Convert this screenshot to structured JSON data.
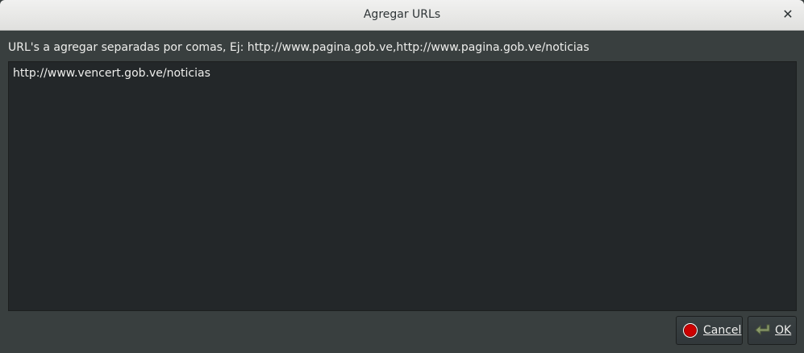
{
  "window": {
    "title": "Agregar URLs",
    "close_glyph": "✕"
  },
  "instructions": "URL's a agregar separadas por comas, Ej: http://www.pagina.gob.ve,http://www.pagina.gob.ve/noticias",
  "url_input": {
    "value": "http://www.vencert.gob.ve/noticias"
  },
  "buttons": {
    "cancel": {
      "label": "Cancel",
      "icon": "stop-icon"
    },
    "ok": {
      "label": "OK",
      "icon": "return-arrow-icon"
    }
  },
  "colors": {
    "background": "#393f3f",
    "text_area": "#232729",
    "stop_red": "#cc0000"
  }
}
